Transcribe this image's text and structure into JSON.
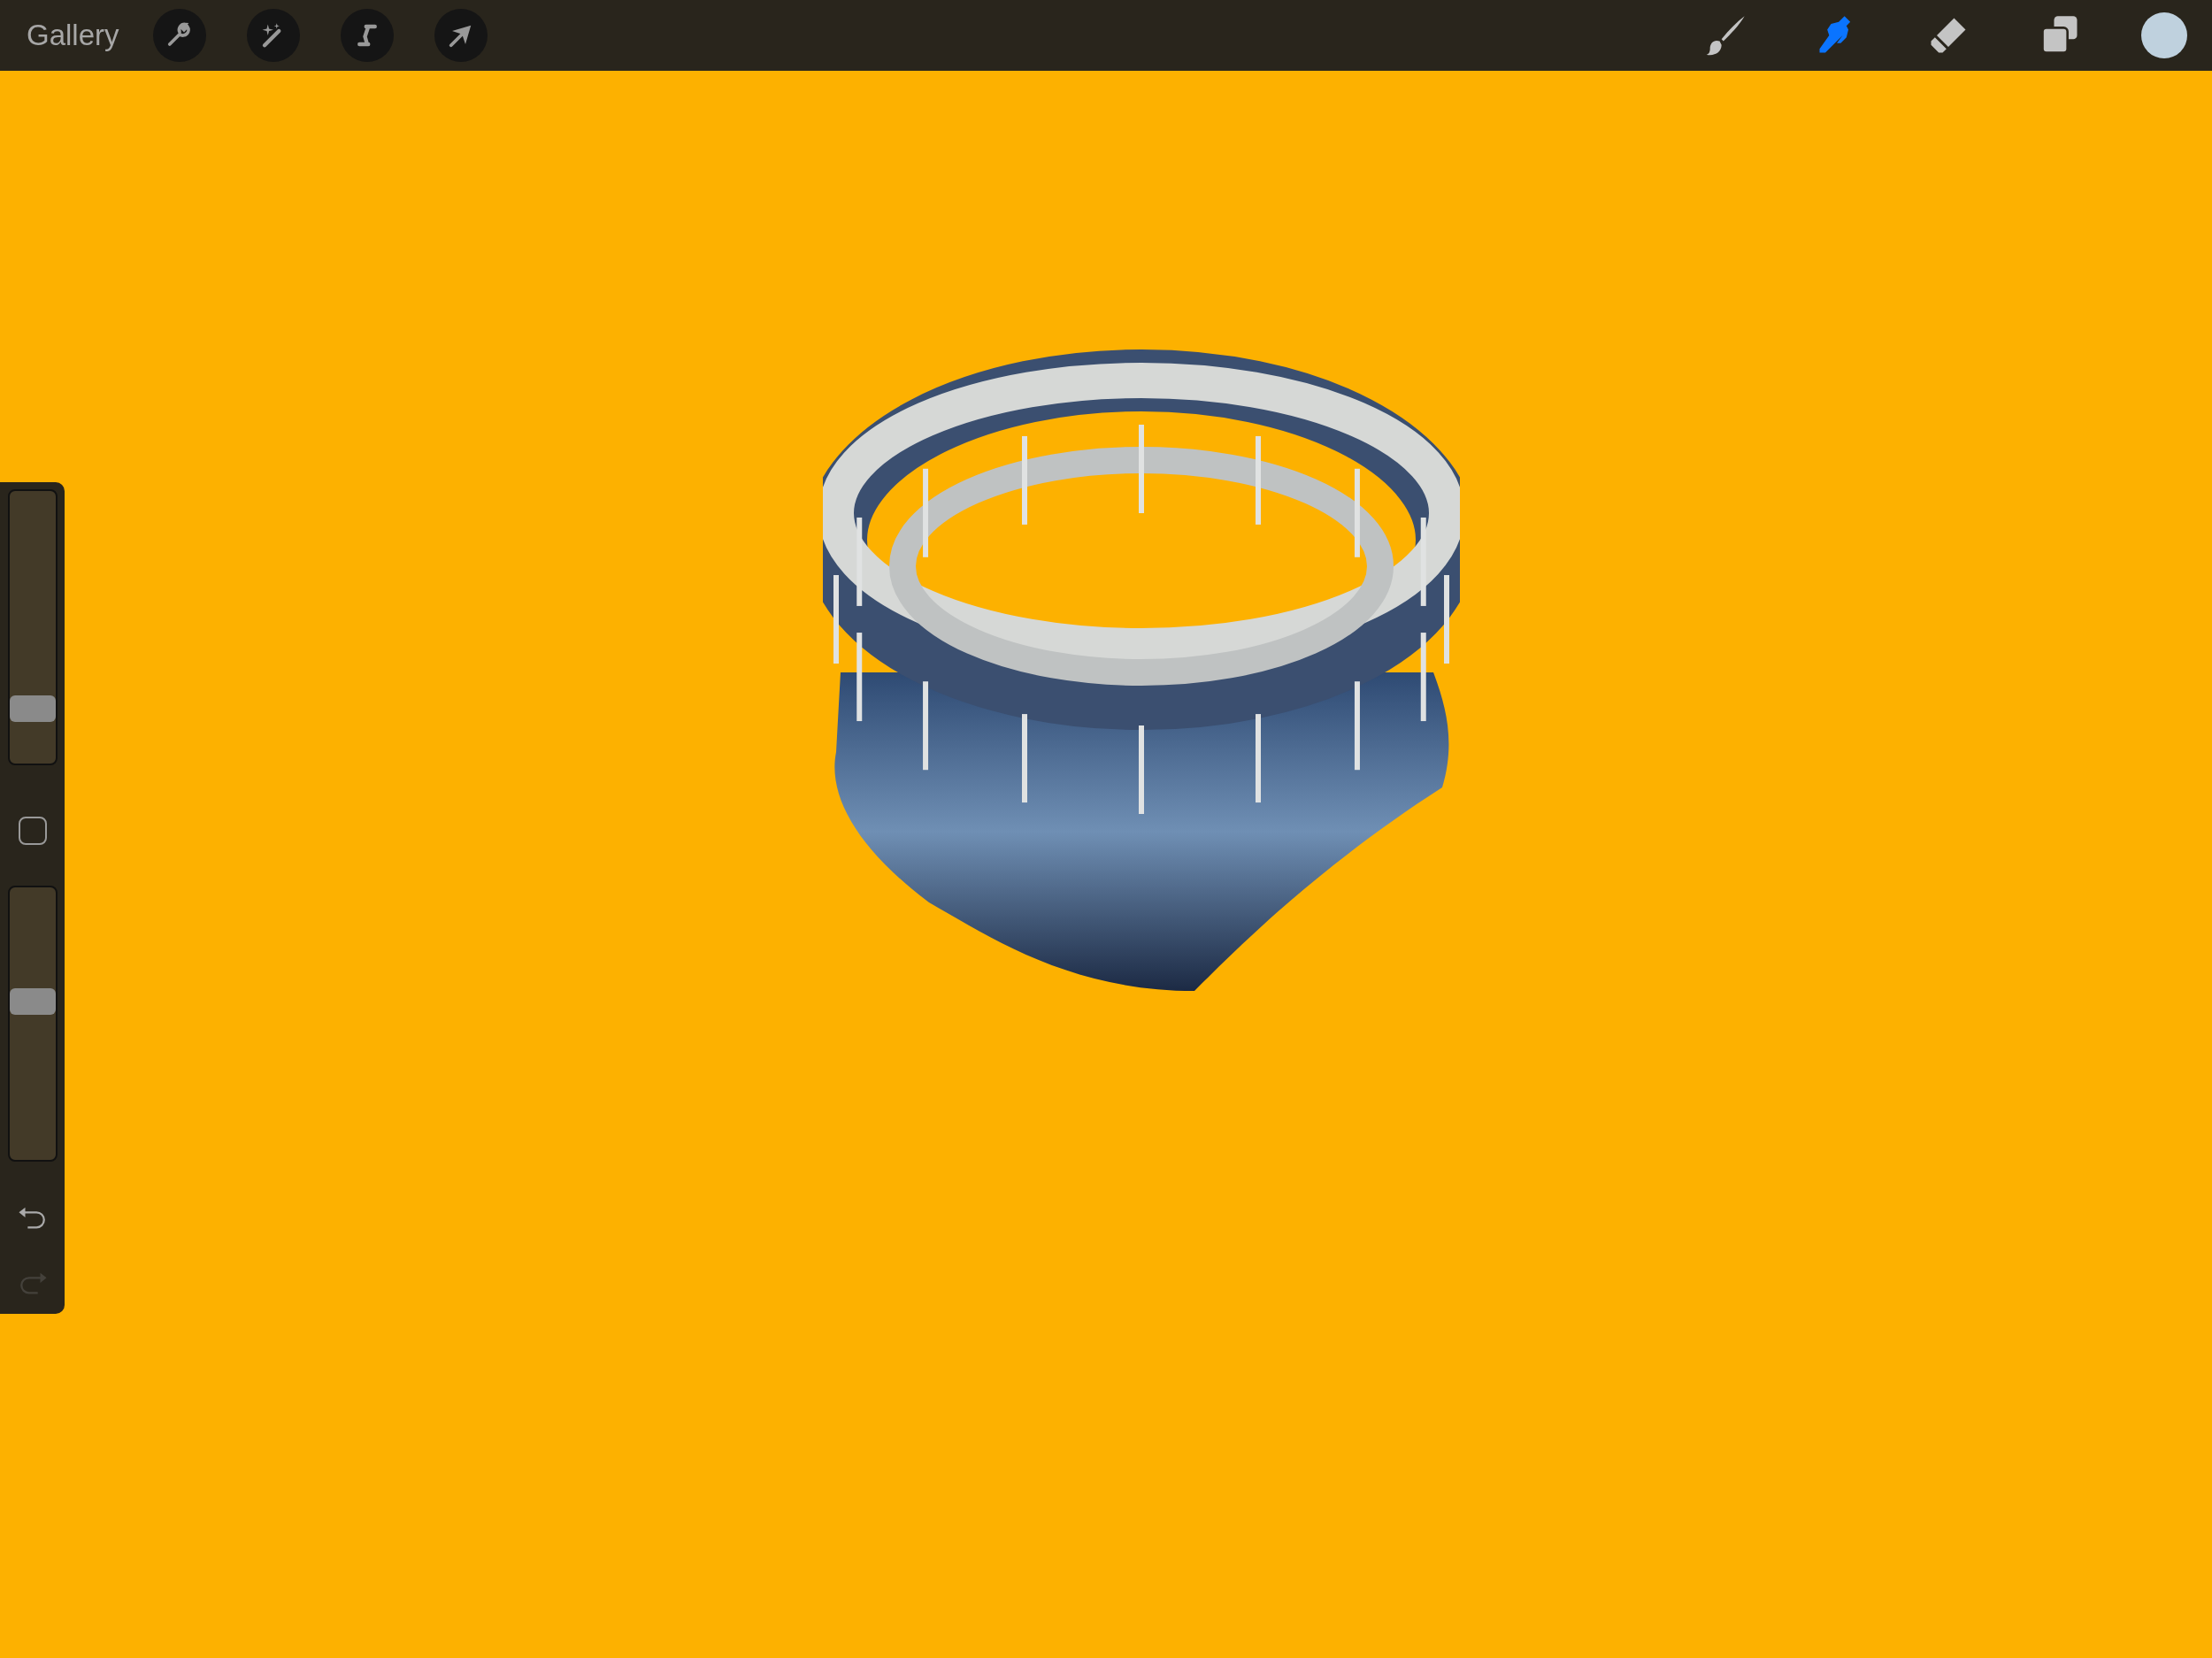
{
  "toolbar": {
    "gallery": "Gallery",
    "actions": [
      {
        "kind": "wrench"
      },
      {
        "kind": "wand"
      },
      {
        "kind": "selection"
      },
      {
        "kind": "transform"
      }
    ],
    "tools": [
      {
        "kind": "brush",
        "selected": false
      },
      {
        "kind": "smudge",
        "selected": true
      },
      {
        "kind": "eraser",
        "selected": false
      },
      {
        "kind": "layers",
        "selected": false
      }
    ],
    "color_swatch": {
      "color": "#bfd1de"
    }
  },
  "sidebar": {
    "sliders": [
      {
        "level": 0.17
      },
      {
        "level": 0.59
      }
    ],
    "undo": {
      "disabled": false
    },
    "redo": {
      "disabled": true
    }
  }
}
